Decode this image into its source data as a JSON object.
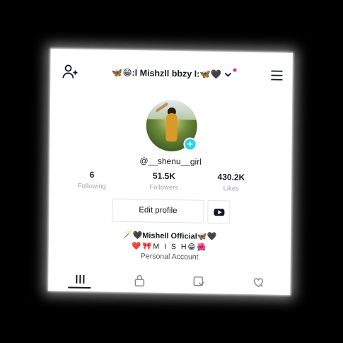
{
  "header": {
    "title": "🦋😁:l Mishzll bbzy l:🦋🖤"
  },
  "profile": {
    "handle": "@__shenu__girl"
  },
  "stats": [
    {
      "value": "6",
      "label": "Following"
    },
    {
      "value": "51.5K",
      "label": "Followers"
    },
    {
      "value": "430.2K",
      "label": "Likes"
    }
  ],
  "actions": {
    "edit_profile": "Edit profile"
  },
  "bio": {
    "line1": "🪄🖤Mishell Official🦋🖤",
    "line2": "❤️🎀M I S H😁🌺",
    "line3": "Personal Account"
  },
  "icons": {
    "add_user": "add-user-icon",
    "chevron": "chevron-down-icon",
    "menu": "hamburger-menu-icon",
    "youtube": "youtube-icon",
    "tab_videos": "grid-icon",
    "tab_private": "lock-icon",
    "tab_reposts": "repost-icon",
    "tab_liked": "heart-icon"
  },
  "colors": {
    "accent": "#20d5ec",
    "notification_dot": "#fe2c55",
    "text": "#161823",
    "muted": "#a7a8ad"
  }
}
